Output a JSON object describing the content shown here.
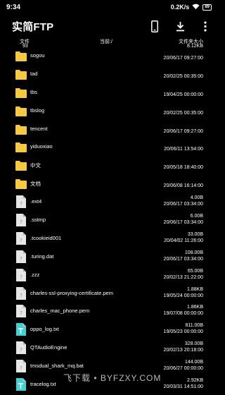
{
  "status": {
    "time": "9:34",
    "speed": "0.2K/s",
    "battery": "89"
  },
  "app": {
    "title": "实简FTP"
  },
  "icons": {
    "phone": "phone-icon",
    "download": "download-icon",
    "more": "more-vertical-icon"
  },
  "info": {
    "label_file": "文件",
    "file_count": "93",
    "path": "当前:/",
    "label_size": "文件夹大小",
    "total_size": "8.12KB"
  },
  "colors": {
    "folder": "#f7c842",
    "text_file": "#3fd3d7",
    "doc_file": "#e6e6e6"
  },
  "rows": [
    {
      "name": "sogou",
      "type": "folder",
      "size": "",
      "date": "20/06/17 09:27:00"
    },
    {
      "name": "tad",
      "type": "folder",
      "size": "",
      "date": "20/02/25 00:35:00"
    },
    {
      "name": "tbs",
      "type": "folder",
      "size": "",
      "date": "19/04/25 00:00:00"
    },
    {
      "name": "tbslog",
      "type": "folder",
      "size": "",
      "date": "20/02/25 00:35:00"
    },
    {
      "name": "tencent",
      "type": "folder",
      "size": "",
      "date": "20/06/17 09:27:00"
    },
    {
      "name": "yiduoxiao",
      "type": "folder",
      "size": "",
      "date": "20/06/11 13:54:00"
    },
    {
      "name": "中文",
      "type": "folder",
      "size": "",
      "date": "20/05/18 18:40:00"
    },
    {
      "name": "文档",
      "type": "folder",
      "size": "",
      "date": "20/06/08 16:14:00"
    },
    {
      "name": ".ext4",
      "type": "doc",
      "size": "4.00B",
      "date": "20/06/17 03:34:00"
    },
    {
      "name": ".sstmp",
      "type": "doc",
      "size": "6.00B",
      "date": "20/06/17 03:34:00"
    },
    {
      "name": ".tcookieid001",
      "type": "doc",
      "size": "33.00B",
      "date": "20/04/02 11:26:00"
    },
    {
      "name": ".turing.dat",
      "type": "doc",
      "size": "108.00B",
      "date": "20/06/17 03:34:00"
    },
    {
      "name": ".zzz",
      "type": "doc",
      "size": "65.00B",
      "date": "20/02/13 21:22:00"
    },
    {
      "name": "charles-ssl-proxying-certificate.pem",
      "type": "doc",
      "size": "1.88KB",
      "date": "19/05/24 00:00:00"
    },
    {
      "name": "charles_mac_phone.pem",
      "type": "doc",
      "size": "1.86KB",
      "date": "19/07/08 00:00:00"
    },
    {
      "name": "oppo_log.txt",
      "type": "txt",
      "size": "811.00B",
      "date": "19/05/23 00:00:00"
    },
    {
      "name": "QTAudioEngine",
      "type": "doc",
      "size": "328.00B",
      "date": "20/02/13 20:18:00"
    },
    {
      "name": "tmsdual_shark_mq.bat",
      "type": "doc",
      "size": "144.00B",
      "date": "20/06/27 00:00:00"
    },
    {
      "name": "tracelog.txt",
      "type": "txt",
      "size": "2.92KB",
      "date": "20/03/31 14:51:00"
    }
  ],
  "watermark": "飞下载 • BYFZXY.COM"
}
